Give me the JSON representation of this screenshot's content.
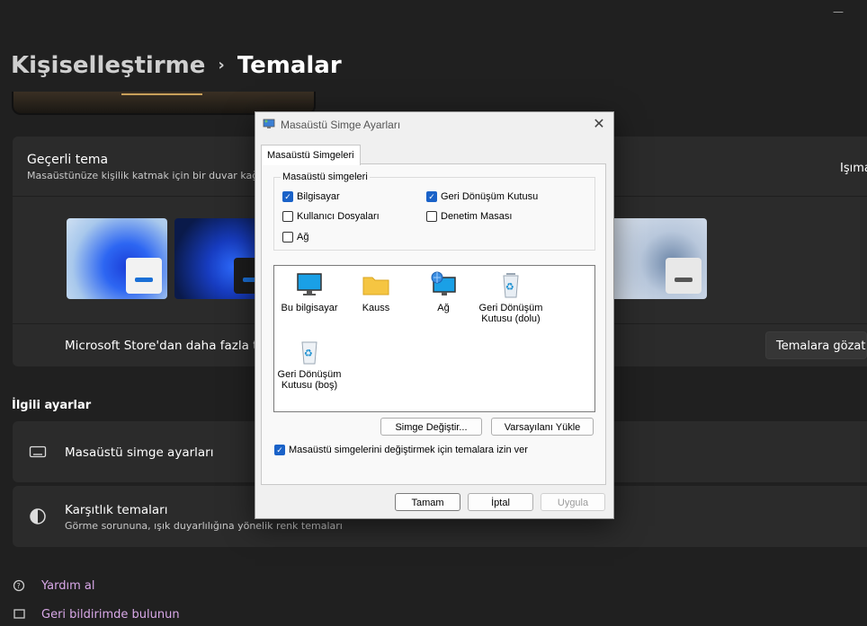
{
  "window": {
    "minimize_glyph": "—"
  },
  "breadcrumb": {
    "parent": "Kişiselleştirme",
    "separator": "›",
    "current": "Temalar"
  },
  "theme_card": {
    "title": "Geçerli tema",
    "subtitle": "Masaüstünüze kişilik katmak için bir duvar kağı",
    "right_label": "Işıma",
    "store_label": "Microsoft Store'dan daha fazla tem",
    "browse_button": "Temalara gözat"
  },
  "related": {
    "title": "İlgili ayarlar",
    "items": [
      {
        "title": "Masaüstü simge ayarları",
        "subtitle": "",
        "icon": "monitor-icon"
      },
      {
        "title": "Karşıtlık temaları",
        "subtitle": "Görme sorununa, ışık duyarlılığına yönelik renk temaları",
        "icon": "contrast-icon"
      }
    ]
  },
  "links": {
    "help": "Yardım al",
    "feedback": "Geri bildirimde bulunun"
  },
  "dialog": {
    "title": "Masaüstü Simge Ayarları",
    "close_glyph": "✕",
    "tab": "Masaüstü Simgeleri",
    "group_title": "Masaüstü simgeleri",
    "checkboxes": [
      {
        "label": "Bilgisayar",
        "checked": true
      },
      {
        "label": "Geri Dönüşüm Kutusu",
        "checked": true
      },
      {
        "label": "Kullanıcı Dosyaları",
        "checked": false
      },
      {
        "label": "Denetim Masası",
        "checked": false
      },
      {
        "label": "Ağ",
        "checked": false
      }
    ],
    "icons": [
      {
        "label": "Bu bilgisayar",
        "icon": "computer-icon"
      },
      {
        "label": "Kauss",
        "icon": "folder-icon"
      },
      {
        "label": "Ağ",
        "icon": "network-icon"
      },
      {
        "label": "Geri Dönüşüm Kutusu (dolu)",
        "icon": "recycle-bin-full-icon"
      },
      {
        "label": "Geri Dönüşüm Kutusu (boş)",
        "icon": "recycle-bin-empty-icon"
      }
    ],
    "change_icon_button": "Simge Değiştir...",
    "restore_default_button": "Varsayılanı Yükle",
    "allow_themes_checkbox": {
      "label": "Masaüstü simgelerini değiştirmek için temalara izin ver",
      "checked": true
    },
    "ok_button": "Tamam",
    "cancel_button": "İptal",
    "apply_button": "Uygula"
  },
  "colors": {
    "accent": "#1a62c8",
    "link": "#d9a8e8",
    "background": "#202020",
    "card": "#2b2b2b"
  }
}
